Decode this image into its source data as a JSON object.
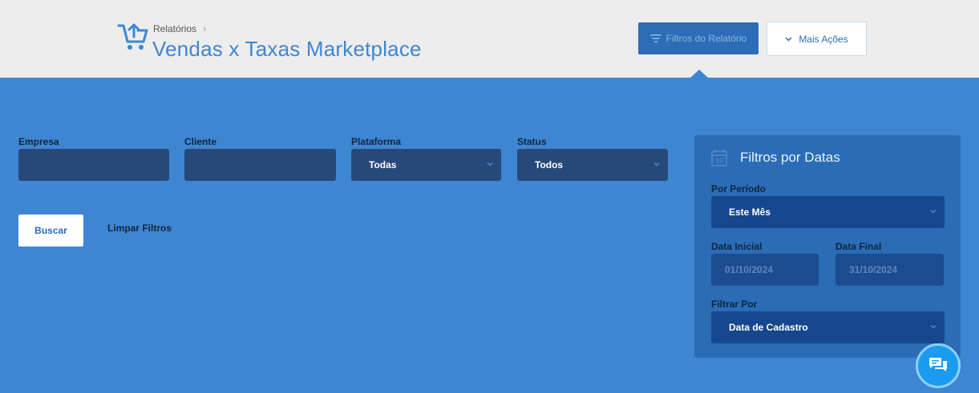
{
  "header": {
    "breadcrumb": "Relatórios",
    "title": "Vendas x Taxas Marketplace",
    "filters_button": "Filtros do Relatório",
    "actions_button": "Mais Ações"
  },
  "filters": {
    "empresa": {
      "label": "Empresa",
      "value": ""
    },
    "cliente": {
      "label": "Cliente",
      "value": ""
    },
    "plataforma": {
      "label": "Plataforma",
      "value": "Todas"
    },
    "status": {
      "label": "Status",
      "value": "Todos"
    },
    "search_button": "Buscar",
    "clear_button": "Limpar Filtros"
  },
  "date_filters": {
    "title": "Filtros por Datas",
    "period": {
      "label": "Por Período",
      "value": "Este Mês"
    },
    "start_date": {
      "label": "Data Inicial",
      "value": "01/10/2024"
    },
    "end_date": {
      "label": "Data Final",
      "value": "31/10/2024"
    },
    "filter_by": {
      "label": "Filtrar Por",
      "value": "Data de Cadastro"
    }
  },
  "colors": {
    "background": "#3f86d2",
    "topbar": "#ededed",
    "accent": "#2b6db6",
    "input": "#27497a",
    "panel": "#2a6cb6",
    "chat": "#1b9bf0"
  },
  "icons": [
    "cart-upload-icon",
    "chevron-right-icon",
    "filter-icon",
    "chevron-down-icon",
    "calendar-icon",
    "chat-icon"
  ]
}
